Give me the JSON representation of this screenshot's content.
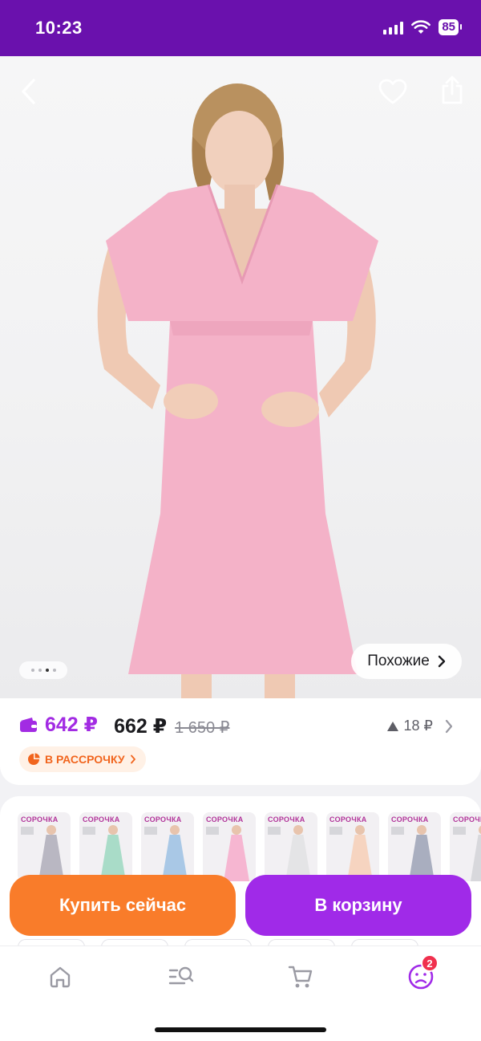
{
  "status_bar": {
    "time": "10:23",
    "battery": "85"
  },
  "hero": {
    "icons": {
      "back": "chevron-left-icon",
      "favorite": "heart-icon",
      "share": "share-icon"
    },
    "dots_count": 4,
    "active_dot": 2,
    "similar_label": "Похожие"
  },
  "price": {
    "wallet_price": "642 ₽",
    "price": "662 ₽",
    "old_price": "1 650 ₽",
    "trend": "18 ₽",
    "installment_label": "В РАССРОЧКУ"
  },
  "variants": {
    "thumbnails": [
      {
        "brand": "СОРОЧКА",
        "color": "#b9b7c2"
      },
      {
        "brand": "СОРОЧКА",
        "color": "#a9dcc8"
      },
      {
        "brand": "СОРОЧКА",
        "color": "#a9c8e6"
      },
      {
        "brand": "СОРОЧКА",
        "color": "#f6b6d1"
      },
      {
        "brand": "СОРОЧКА",
        "color": "#e4e4e6"
      },
      {
        "brand": "СОРОЧКА",
        "color": "#f6d4c0"
      },
      {
        "brand": "СОРОЧКА",
        "color": "#a9aebf"
      },
      {
        "brand": "СОРОЧКА",
        "color": "#d8d8dc"
      }
    ]
  },
  "actions": {
    "buy_now": "Купить сейчас",
    "add_to_cart": "В корзину"
  },
  "tabs": [
    {
      "name": "home",
      "icon": "home-icon"
    },
    {
      "name": "catalog",
      "icon": "catalog-search-icon"
    },
    {
      "name": "cart",
      "icon": "cart-icon"
    },
    {
      "name": "profile",
      "icon": "profile-icon",
      "badge": "2"
    }
  ],
  "colors": {
    "status_bar": "#6a11ad",
    "accent_purple": "#a02ae8",
    "accent_orange": "#f97c2a",
    "badge": "#f0304e"
  }
}
